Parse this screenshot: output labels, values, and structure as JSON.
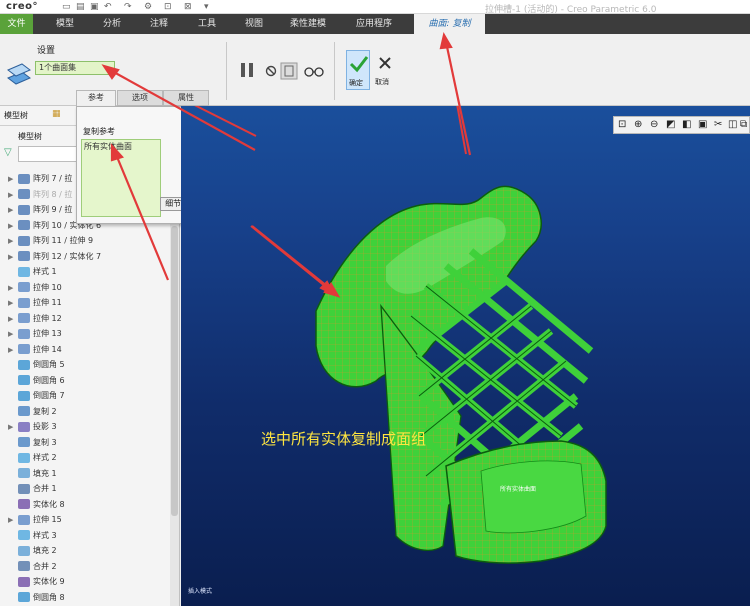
{
  "window": {
    "logo": "creo°",
    "title": "拉伸槽-1 (活动的) - Creo Parametric 6.0"
  },
  "menu": {
    "file": "文件",
    "items": [
      "模型",
      "分析",
      "注释",
      "工具",
      "视图",
      "柔性建模",
      "应用程序"
    ],
    "active_tab": "曲面: 复制"
  },
  "ribbon": {
    "settings_label": "设置",
    "surface_set_value": "1个曲面集",
    "ok_label": "确定",
    "cancel_label": "取消"
  },
  "subtabs": {
    "references": "参考",
    "options": "选项",
    "properties": "属性"
  },
  "popup": {
    "copy_refs_label": "复制参考",
    "selected_item": "所有实体曲面",
    "details_button": "细节..."
  },
  "left_panel": {
    "tab_model_tree": "模型树",
    "title": "模型树",
    "tree_items": [
      "阵列 7 / 拉",
      "阵列 8 / 拉",
      "阵列 9 / 拉",
      "阵列 10 / 实体化 6",
      "阵列 11 / 拉伸 9",
      "阵列 12 / 实体化 7",
      "样式 1",
      "拉伸 10",
      "拉伸 11",
      "拉伸 12",
      "拉伸 13",
      "拉伸 14",
      "倒圆角 5",
      "倒圆角 6",
      "倒圆角 7",
      "复制 2",
      "投影 3",
      "复制 3",
      "样式 2",
      "填充 1",
      "合并 1",
      "实体化 8",
      "拉伸 15",
      "样式 3",
      "填充 2",
      "合并 2",
      "实体化 9",
      "倒圆角 8"
    ]
  },
  "viewport": {
    "annotation": "选中所有实体复制成面组",
    "model_label": "所有实体曲面",
    "corner_text": "插入模式"
  },
  "colors": {
    "menubar": "#3c3c3c",
    "file_menu": "#5aa23a",
    "active_tab_text": "#2a6fb0",
    "selection_fill": "#e5f6cc",
    "model_green": "#3fd13a",
    "annotation_yellow": "#ffe640",
    "arrow_red": "#e23a3a"
  }
}
